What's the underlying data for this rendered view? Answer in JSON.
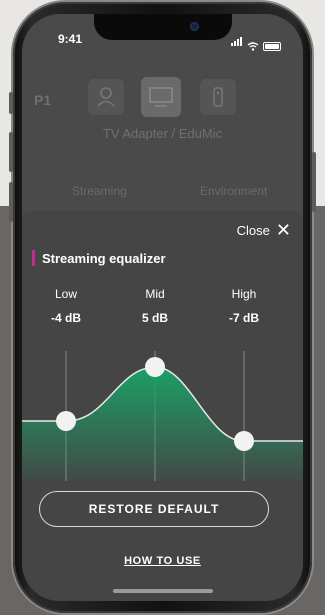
{
  "statusbar": {
    "time": "9:41"
  },
  "app": {
    "program": "P1",
    "device_name": "TV Adapter / EduMic",
    "tabs": [
      "Streaming",
      "Environment"
    ]
  },
  "sheet": {
    "close_label": "Close",
    "title": "Streaming equalizer",
    "bands": [
      {
        "label": "Low",
        "value": "-4 dB"
      },
      {
        "label": "Mid",
        "value": "5 dB"
      },
      {
        "label": "High",
        "value": "-7 dB"
      }
    ],
    "restore_label": "RESTORE DEFAULT",
    "howto_label": "HOW TO USE"
  },
  "colors": {
    "accent": "#b8328a",
    "curve_fill": "#1aa067"
  },
  "icons": [
    "person-icon",
    "tv-icon",
    "remote-icon",
    "close-icon",
    "signal-icon",
    "wifi-icon",
    "battery-icon"
  ]
}
